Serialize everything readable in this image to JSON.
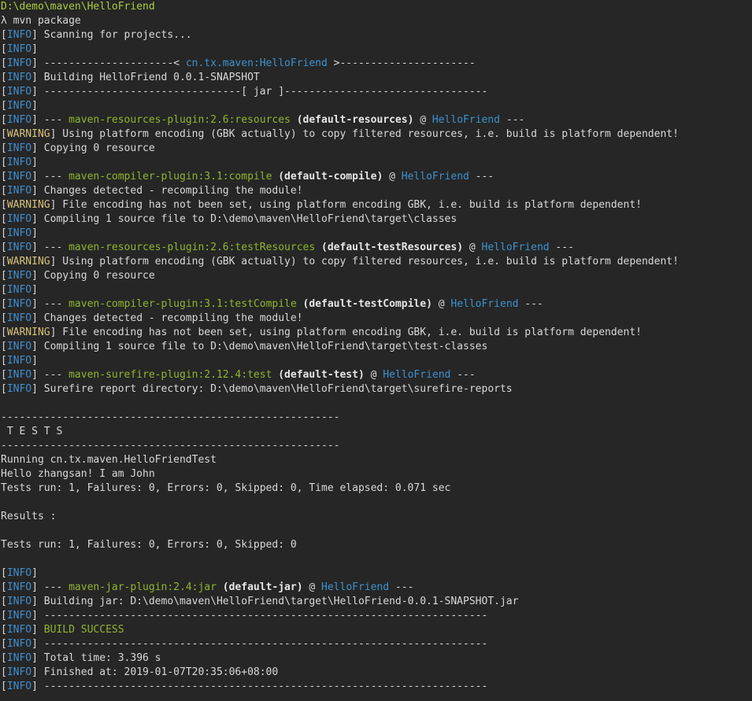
{
  "window": {
    "kind": "terminal",
    "prompt_path": "D:\\demo\\maven\\HelloFriend",
    "prompt_symbol": "λ",
    "command": "mvn package"
  },
  "colors": {
    "background": "#262626",
    "text": "#d8d8d8",
    "info": "#3f8fcf",
    "warning": "#d7c27a",
    "plugin": "#8fb52e",
    "artifact": "#3c93cf",
    "success": "#8fb52e",
    "prompt_path": "#a9cd3c"
  },
  "lines": [
    [
      {
        "t": "D:\\demo\\maven\\HelloFriend",
        "c": "path"
      }
    ],
    [
      {
        "t": "λ mvn package",
        "c": "plain"
      }
    ],
    [
      {
        "t": "[",
        "c": "plain"
      },
      {
        "t": "INFO",
        "c": "info"
      },
      {
        "t": "] Scanning for projects...",
        "c": "plain"
      }
    ],
    [
      {
        "t": "[",
        "c": "plain"
      },
      {
        "t": "INFO",
        "c": "info"
      },
      {
        "t": "]",
        "c": "plain"
      }
    ],
    [
      {
        "t": "[",
        "c": "plain"
      },
      {
        "t": "INFO",
        "c": "info"
      },
      {
        "t": "] ---------------------< ",
        "c": "plain"
      },
      {
        "t": "cn.tx.maven:HelloFriend",
        "c": "artifact"
      },
      {
        "t": " >----------------------",
        "c": "plain"
      }
    ],
    [
      {
        "t": "[",
        "c": "plain"
      },
      {
        "t": "INFO",
        "c": "info"
      },
      {
        "t": "] Building HelloFriend 0.0.1-SNAPSHOT",
        "c": "plain"
      }
    ],
    [
      {
        "t": "[",
        "c": "plain"
      },
      {
        "t": "INFO",
        "c": "info"
      },
      {
        "t": "] --------------------------------[ jar ]---------------------------------",
        "c": "plain"
      }
    ],
    [
      {
        "t": "[",
        "c": "plain"
      },
      {
        "t": "INFO",
        "c": "info"
      },
      {
        "t": "]",
        "c": "plain"
      }
    ],
    [
      {
        "t": "[",
        "c": "plain"
      },
      {
        "t": "INFO",
        "c": "info"
      },
      {
        "t": "] --- ",
        "c": "plain"
      },
      {
        "t": "maven-resources-plugin:2.6:resources",
        "c": "plugin"
      },
      {
        "t": " (default-resources)",
        "c": "bold"
      },
      {
        "t": " @ ",
        "c": "plain"
      },
      {
        "t": "HelloFriend",
        "c": "artifact"
      },
      {
        "t": " ---",
        "c": "plain"
      }
    ],
    [
      {
        "t": "[",
        "c": "plain"
      },
      {
        "t": "WARNING",
        "c": "warn"
      },
      {
        "t": "] Using platform encoding (GBK actually) to copy filtered resources, i.e. build is platform dependent!",
        "c": "plain"
      }
    ],
    [
      {
        "t": "[",
        "c": "plain"
      },
      {
        "t": "INFO",
        "c": "info"
      },
      {
        "t": "] Copying 0 resource",
        "c": "plain"
      }
    ],
    [
      {
        "t": "[",
        "c": "plain"
      },
      {
        "t": "INFO",
        "c": "info"
      },
      {
        "t": "]",
        "c": "plain"
      }
    ],
    [
      {
        "t": "[",
        "c": "plain"
      },
      {
        "t": "INFO",
        "c": "info"
      },
      {
        "t": "] --- ",
        "c": "plain"
      },
      {
        "t": "maven-compiler-plugin:3.1:compile",
        "c": "plugin"
      },
      {
        "t": " (default-compile)",
        "c": "bold"
      },
      {
        "t": " @ ",
        "c": "plain"
      },
      {
        "t": "HelloFriend",
        "c": "artifact"
      },
      {
        "t": " ---",
        "c": "plain"
      }
    ],
    [
      {
        "t": "[",
        "c": "plain"
      },
      {
        "t": "INFO",
        "c": "info"
      },
      {
        "t": "] Changes detected - recompiling the module!",
        "c": "plain"
      }
    ],
    [
      {
        "t": "[",
        "c": "plain"
      },
      {
        "t": "WARNING",
        "c": "warn"
      },
      {
        "t": "] File encoding has not been set, using platform encoding GBK, i.e. build is platform dependent!",
        "c": "plain"
      }
    ],
    [
      {
        "t": "[",
        "c": "plain"
      },
      {
        "t": "INFO",
        "c": "info"
      },
      {
        "t": "] Compiling 1 source file to D:\\demo\\maven\\HelloFriend\\target\\classes",
        "c": "plain"
      }
    ],
    [
      {
        "t": "[",
        "c": "plain"
      },
      {
        "t": "INFO",
        "c": "info"
      },
      {
        "t": "]",
        "c": "plain"
      }
    ],
    [
      {
        "t": "[",
        "c": "plain"
      },
      {
        "t": "INFO",
        "c": "info"
      },
      {
        "t": "] --- ",
        "c": "plain"
      },
      {
        "t": "maven-resources-plugin:2.6:testResources",
        "c": "plugin"
      },
      {
        "t": " (default-testResources)",
        "c": "bold"
      },
      {
        "t": " @ ",
        "c": "plain"
      },
      {
        "t": "HelloFriend",
        "c": "artifact"
      },
      {
        "t": " ---",
        "c": "plain"
      }
    ],
    [
      {
        "t": "[",
        "c": "plain"
      },
      {
        "t": "WARNING",
        "c": "warn"
      },
      {
        "t": "] Using platform encoding (GBK actually) to copy filtered resources, i.e. build is platform dependent!",
        "c": "plain"
      }
    ],
    [
      {
        "t": "[",
        "c": "plain"
      },
      {
        "t": "INFO",
        "c": "info"
      },
      {
        "t": "] Copying 0 resource",
        "c": "plain"
      }
    ],
    [
      {
        "t": "[",
        "c": "plain"
      },
      {
        "t": "INFO",
        "c": "info"
      },
      {
        "t": "]",
        "c": "plain"
      }
    ],
    [
      {
        "t": "[",
        "c": "plain"
      },
      {
        "t": "INFO",
        "c": "info"
      },
      {
        "t": "] --- ",
        "c": "plain"
      },
      {
        "t": "maven-compiler-plugin:3.1:testCompile",
        "c": "plugin"
      },
      {
        "t": " (default-testCompile)",
        "c": "bold"
      },
      {
        "t": " @ ",
        "c": "plain"
      },
      {
        "t": "HelloFriend",
        "c": "artifact"
      },
      {
        "t": " ---",
        "c": "plain"
      }
    ],
    [
      {
        "t": "[",
        "c": "plain"
      },
      {
        "t": "INFO",
        "c": "info"
      },
      {
        "t": "] Changes detected - recompiling the module!",
        "c": "plain"
      }
    ],
    [
      {
        "t": "[",
        "c": "plain"
      },
      {
        "t": "WARNING",
        "c": "warn"
      },
      {
        "t": "] File encoding has not been set, using platform encoding GBK, i.e. build is platform dependent!",
        "c": "plain"
      }
    ],
    [
      {
        "t": "[",
        "c": "plain"
      },
      {
        "t": "INFO",
        "c": "info"
      },
      {
        "t": "] Compiling 1 source file to D:\\demo\\maven\\HelloFriend\\target\\test-classes",
        "c": "plain"
      }
    ],
    [
      {
        "t": "[",
        "c": "plain"
      },
      {
        "t": "INFO",
        "c": "info"
      },
      {
        "t": "]",
        "c": "plain"
      }
    ],
    [
      {
        "t": "[",
        "c": "plain"
      },
      {
        "t": "INFO",
        "c": "info"
      },
      {
        "t": "] --- ",
        "c": "plain"
      },
      {
        "t": "maven-surefire-plugin:2.12.4:test",
        "c": "plugin"
      },
      {
        "t": " (default-test)",
        "c": "bold"
      },
      {
        "t": " @ ",
        "c": "plain"
      },
      {
        "t": "HelloFriend",
        "c": "artifact"
      },
      {
        "t": " ---",
        "c": "plain"
      }
    ],
    [
      {
        "t": "[",
        "c": "plain"
      },
      {
        "t": "INFO",
        "c": "info"
      },
      {
        "t": "] Surefire report directory: D:\\demo\\maven\\HelloFriend\\target\\surefire-reports",
        "c": "plain"
      }
    ],
    [],
    [
      {
        "t": "-------------------------------------------------------",
        "c": "plain"
      }
    ],
    [
      {
        "t": " T E S T S",
        "c": "plain"
      }
    ],
    [
      {
        "t": "-------------------------------------------------------",
        "c": "plain"
      }
    ],
    [
      {
        "t": "Running cn.tx.maven.HelloFriendTest",
        "c": "plain"
      }
    ],
    [
      {
        "t": "Hello zhangsan! I am John",
        "c": "plain"
      }
    ],
    [
      {
        "t": "Tests run: 1, Failures: 0, Errors: 0, Skipped: 0, Time elapsed: 0.071 sec",
        "c": "plain"
      }
    ],
    [],
    [
      {
        "t": "Results :",
        "c": "plain"
      }
    ],
    [],
    [
      {
        "t": "Tests run: 1, Failures: 0, Errors: 0, Skipped: 0",
        "c": "plain"
      }
    ],
    [],
    [
      {
        "t": "[",
        "c": "plain"
      },
      {
        "t": "INFO",
        "c": "info"
      },
      {
        "t": "]",
        "c": "plain"
      }
    ],
    [
      {
        "t": "[",
        "c": "plain"
      },
      {
        "t": "INFO",
        "c": "info"
      },
      {
        "t": "] --- ",
        "c": "plain"
      },
      {
        "t": "maven-jar-plugin:2.4:jar",
        "c": "plugin"
      },
      {
        "t": " (default-jar)",
        "c": "bold"
      },
      {
        "t": " @ ",
        "c": "plain"
      },
      {
        "t": "HelloFriend",
        "c": "artifact"
      },
      {
        "t": " ---",
        "c": "plain"
      }
    ],
    [
      {
        "t": "[",
        "c": "plain"
      },
      {
        "t": "INFO",
        "c": "info"
      },
      {
        "t": "] Building jar: D:\\demo\\maven\\HelloFriend\\target\\HelloFriend-0.0.1-SNAPSHOT.jar",
        "c": "plain"
      }
    ],
    [
      {
        "t": "[",
        "c": "plain"
      },
      {
        "t": "INFO",
        "c": "info"
      },
      {
        "t": "] ------------------------------------------------------------------------",
        "c": "plain"
      }
    ],
    [
      {
        "t": "[",
        "c": "plain"
      },
      {
        "t": "INFO",
        "c": "info"
      },
      {
        "t": "] ",
        "c": "plain"
      },
      {
        "t": "BUILD SUCCESS",
        "c": "success"
      }
    ],
    [
      {
        "t": "[",
        "c": "plain"
      },
      {
        "t": "INFO",
        "c": "info"
      },
      {
        "t": "] ------------------------------------------------------------------------",
        "c": "plain"
      }
    ],
    [
      {
        "t": "[",
        "c": "plain"
      },
      {
        "t": "INFO",
        "c": "info"
      },
      {
        "t": "] Total time: 3.396 s",
        "c": "plain"
      }
    ],
    [
      {
        "t": "[",
        "c": "plain"
      },
      {
        "t": "INFO",
        "c": "info"
      },
      {
        "t": "] Finished at: 2019-01-07T20:35:06+08:00",
        "c": "plain"
      }
    ],
    [
      {
        "t": "[",
        "c": "plain"
      },
      {
        "t": "INFO",
        "c": "info"
      },
      {
        "t": "] ------------------------------------------------------------------------",
        "c": "plain"
      }
    ]
  ]
}
